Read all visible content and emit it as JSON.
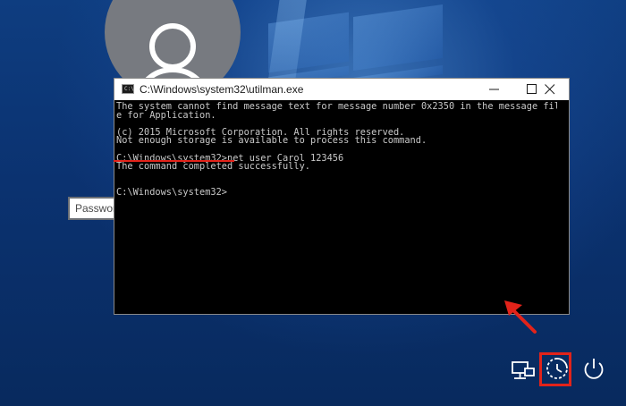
{
  "lockscreen": {
    "password_placeholder": "Password"
  },
  "cmd_window": {
    "title": "C:\\Windows\\system32\\utilman.exe",
    "icon_label": "C:\\",
    "lines": [
      "The system cannot find message text for message number 0x2350 in the message fil",
      "e for Application.",
      "",
      "(c) 2015 Microsoft Corporation. All rights reserved.",
      "Not enough storage is available to process this command.",
      "",
      "C:\\Windows\\system32>net user Carol 123456",
      "The command completed successfully.",
      "",
      "",
      "C:\\Windows\\system32>"
    ],
    "prompt": "C:\\Windows\\system32>",
    "typed_command": "net user Carol 123456"
  },
  "colors": {
    "annotation": "#e2231a",
    "console_text": "#c8c8c8",
    "console_bg": "#000000"
  },
  "tray": {
    "icons": [
      "network-icon",
      "ease-of-access-icon",
      "power-icon"
    ]
  }
}
